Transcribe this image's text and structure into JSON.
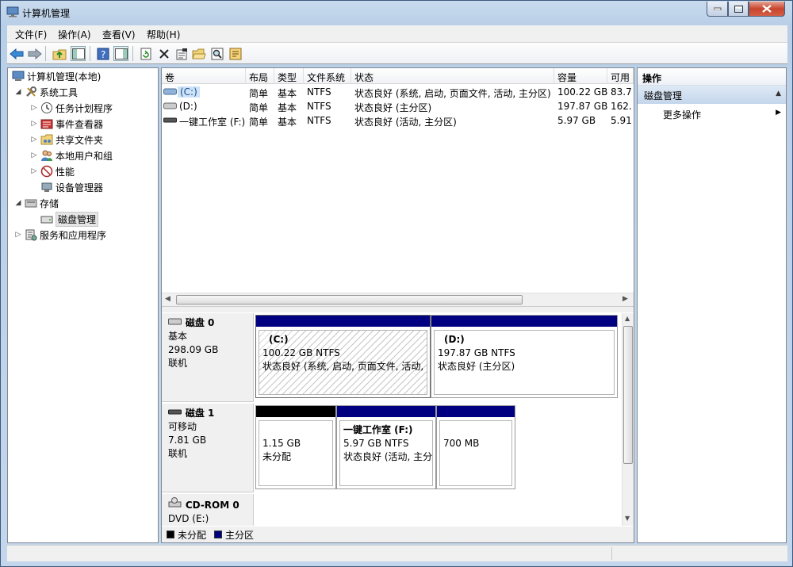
{
  "window": {
    "title": "计算机管理"
  },
  "menu": [
    "文件(F)",
    "操作(A)",
    "查看(V)",
    "帮助(H)"
  ],
  "toolbar": [
    "back-icon",
    "forward-icon",
    "up-icon",
    "show-hide-tree-icon",
    "help-icon",
    "show-hide-action-icon",
    "refresh-icon",
    "delete-icon",
    "properties-icon",
    "open-icon",
    "search-icon",
    "export-icon"
  ],
  "tree": {
    "root": "计算机管理(本地)",
    "items": [
      {
        "label": "系统工具",
        "level": 1,
        "expanded": true,
        "icon": "tools-icon"
      },
      {
        "label": "任务计划程序",
        "level": 2,
        "expanded": false,
        "icon": "clock-icon"
      },
      {
        "label": "事件查看器",
        "level": 2,
        "expanded": false,
        "icon": "event-viewer-icon"
      },
      {
        "label": "共享文件夹",
        "level": 2,
        "expanded": false,
        "icon": "shared-folder-icon"
      },
      {
        "label": "本地用户和组",
        "level": 2,
        "expanded": false,
        "icon": "users-icon"
      },
      {
        "label": "性能",
        "level": 2,
        "expanded": false,
        "icon": "performance-icon"
      },
      {
        "label": "设备管理器",
        "level": 2,
        "expanded": null,
        "icon": "device-manager-icon"
      },
      {
        "label": "存储",
        "level": 1,
        "expanded": true,
        "icon": "storage-icon"
      },
      {
        "label": "磁盘管理",
        "level": 2,
        "expanded": null,
        "icon": "disk-management-icon",
        "selected": true
      },
      {
        "label": "服务和应用程序",
        "level": 1,
        "expanded": false,
        "icon": "services-icon"
      }
    ]
  },
  "volumes": {
    "headers": [
      "卷",
      "布局",
      "类型",
      "文件系统",
      "状态",
      "容量",
      "可用"
    ],
    "rows": [
      [
        "(C:)",
        "简单",
        "基本",
        "NTFS",
        "状态良好 (系统, 启动, 页面文件, 活动, 主分区)",
        "100.22 GB",
        "83.7"
      ],
      [
        "(D:)",
        "简单",
        "基本",
        "NTFS",
        "状态良好 (主分区)",
        "197.87 GB",
        "162."
      ],
      [
        "一键工作室 (F:)",
        "简单",
        "基本",
        "NTFS",
        "状态良好 (活动, 主分区)",
        "5.97 GB",
        "5.91"
      ]
    ]
  },
  "disks": [
    {
      "name": "磁盘 0",
      "type": "基本",
      "size": "298.09 GB",
      "status": "联机",
      "partitions": [
        {
          "title": "(C:)",
          "line1": "100.22 GB NTFS",
          "line2": "状态良好 (系统, 启动, 页面文件, 活动, 主分区)",
          "bar": "#000080",
          "hatched": true
        },
        {
          "title": "(D:)",
          "line1": "197.87 GB NTFS",
          "line2": "状态良好 (主分区)",
          "bar": "#000080",
          "hatched": false
        }
      ]
    },
    {
      "name": "磁盘 1",
      "type": "可移动",
      "size": "7.81 GB",
      "status": "联机",
      "partitions": [
        {
          "title": "",
          "line1": "1.15 GB",
          "line2": "未分配",
          "bar": "#000000",
          "hatched": false
        },
        {
          "title": "一键工作室  (F:)",
          "line1": "5.97 GB NTFS",
          "line2": "状态良好 (活动, 主分区)",
          "bar": "#000080",
          "hatched": false
        },
        {
          "title": "",
          "line1": "700 MB",
          "line2": "",
          "bar": "#000080",
          "hatched": false
        }
      ]
    },
    {
      "name": "CD-ROM 0",
      "type": "DVD (E:)",
      "size": "",
      "status": ""
    }
  ],
  "legend": [
    {
      "label": "未分配",
      "color": "#000000"
    },
    {
      "label": "主分区",
      "color": "#000080"
    }
  ],
  "actions": {
    "header": "操作",
    "section": "磁盘管理",
    "more": "更多操作"
  }
}
